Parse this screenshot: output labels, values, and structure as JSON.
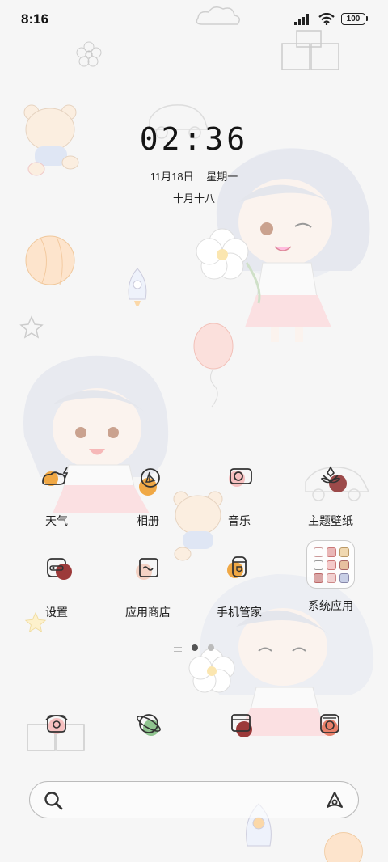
{
  "status_bar": {
    "time": "8:16",
    "battery": "100"
  },
  "clock": {
    "time": "02:36",
    "date": "11月18日",
    "weekday": "星期一",
    "lunar": "十月十八"
  },
  "apps_row1": [
    {
      "label": "天气",
      "icon": "weather-icon",
      "accent": "#f0a845"
    },
    {
      "label": "相册",
      "icon": "gallery-icon",
      "accent": "#f0a845"
    },
    {
      "label": "音乐",
      "icon": "music-icon",
      "accent": "#f29a9a"
    },
    {
      "label": "主题壁纸",
      "icon": "theme-icon",
      "accent": "#9c4a4a"
    }
  ],
  "apps_row2": [
    {
      "label": "设置",
      "icon": "settings-icon",
      "accent": "#9c3a3a"
    },
    {
      "label": "应用商店",
      "icon": "app-store-icon",
      "accent": "#f4c9b8"
    },
    {
      "label": "手机管家",
      "icon": "phone-manager-icon",
      "accent": "#f0a845"
    },
    {
      "label": "系统应用",
      "icon": "system-apps-folder-icon"
    }
  ],
  "dock": [
    {
      "icon": "phone-icon",
      "accent": "#f29a9a"
    },
    {
      "icon": "browser-icon",
      "accent": "#7fb87f"
    },
    {
      "icon": "messages-icon",
      "accent": "#9c3a3a"
    },
    {
      "icon": "camera-icon",
      "accent": "#e8806a"
    }
  ],
  "search": {
    "icon": "search-icon",
    "assistant_icon": "assistant-icon"
  }
}
